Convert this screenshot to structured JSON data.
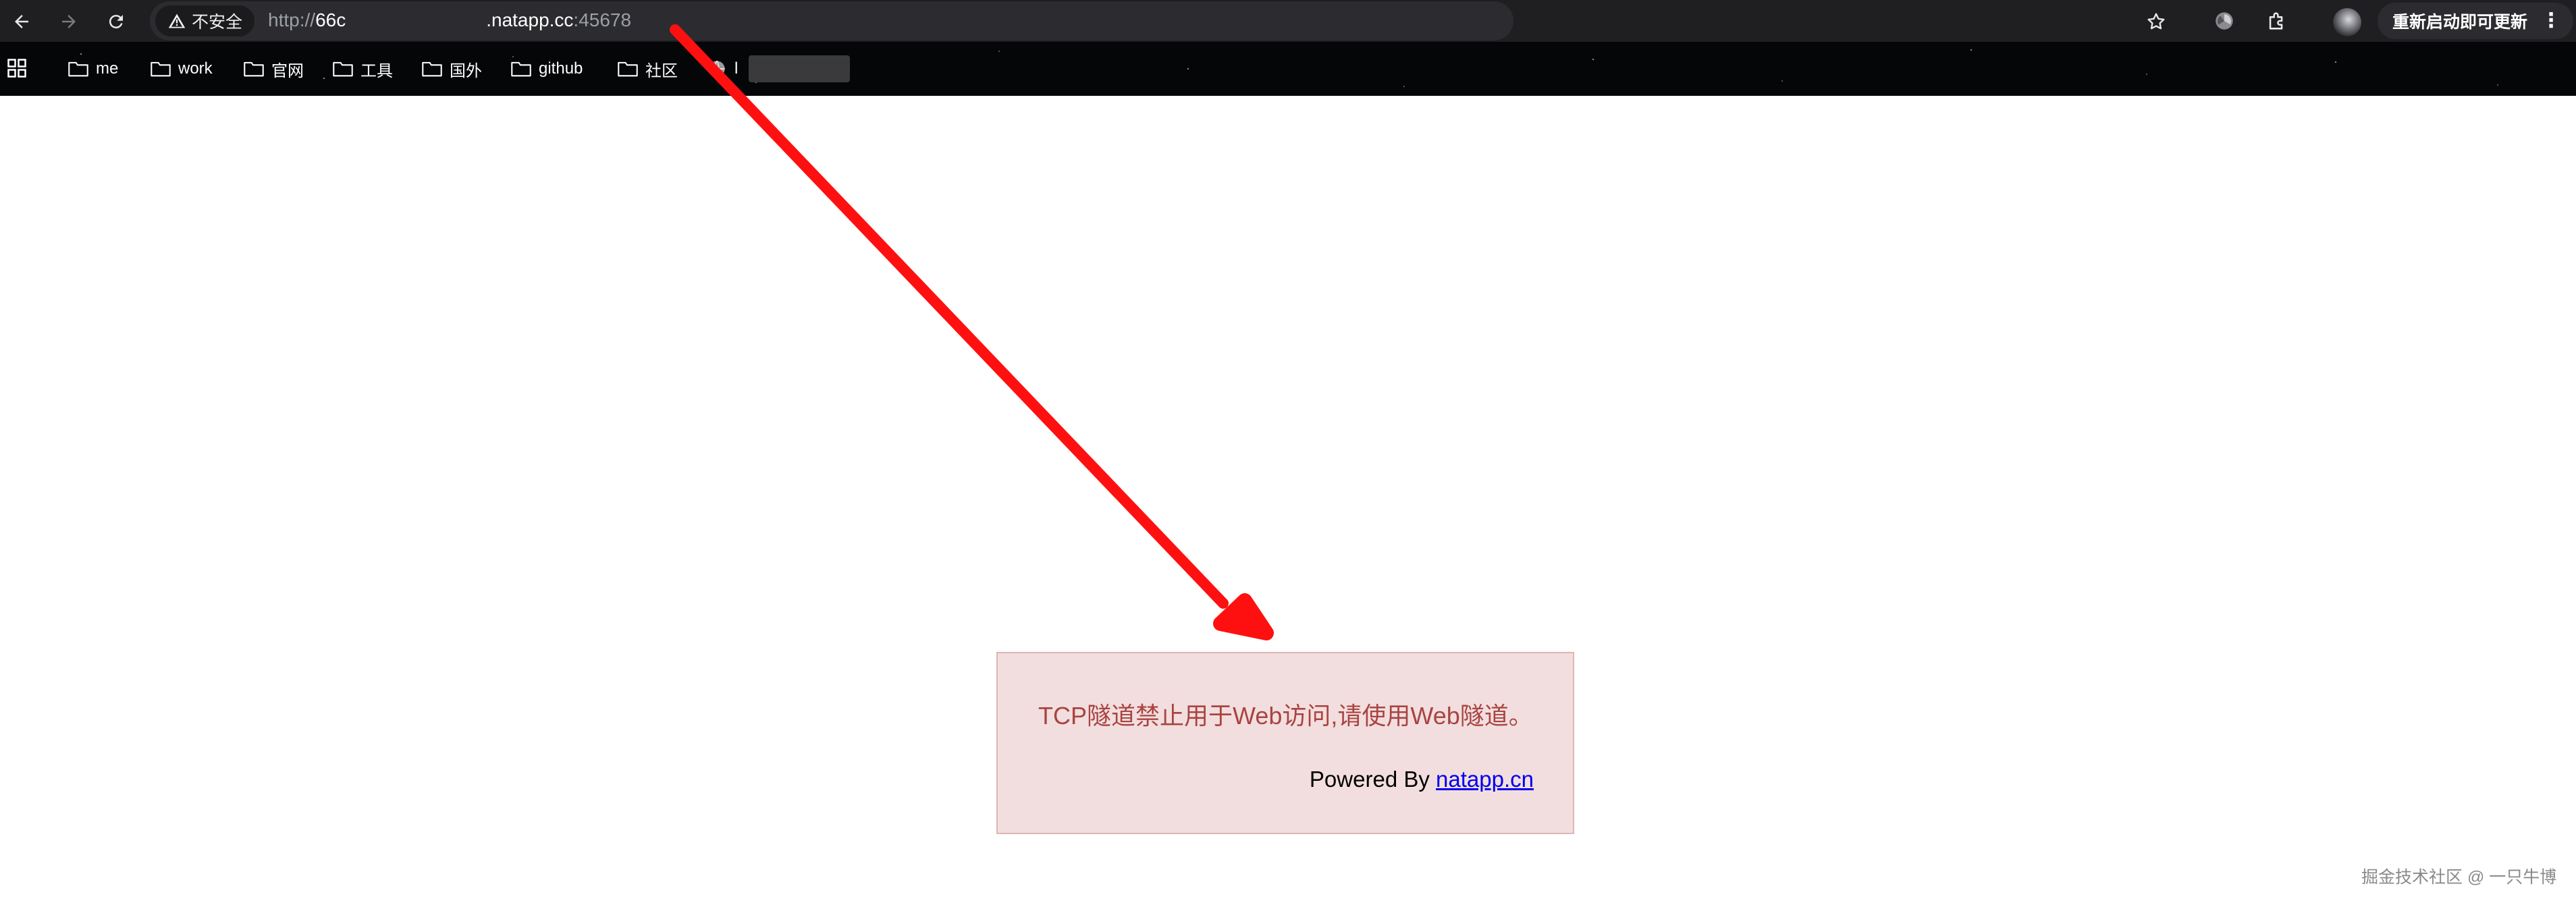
{
  "browser": {
    "security_label": "不安全",
    "url": {
      "scheme": "http://",
      "host_prefix": "66c",
      "host_suffix": ".natapp.cc",
      "port": ":45678"
    },
    "update_button_label": "重新启动即可更新",
    "menu_glyph": "⋮"
  },
  "bookmarks": {
    "items": [
      {
        "label": "me",
        "icon": "folder-icon"
      },
      {
        "label": "work",
        "icon": "folder-icon"
      },
      {
        "label": "官网",
        "icon": "folder-icon"
      },
      {
        "label": "工具",
        "icon": "folder-icon"
      },
      {
        "label": "国外",
        "icon": "folder-icon"
      },
      {
        "label": "github",
        "icon": "folder-icon"
      },
      {
        "label": "社区",
        "icon": "folder-icon"
      },
      {
        "label": "l",
        "icon": "globe-icon"
      }
    ]
  },
  "page": {
    "message": "TCP隧道禁止用于Web访问,请使用Web隧道。",
    "powered_by_label": "Powered By",
    "powered_by_link": "natapp.cn"
  },
  "colors": {
    "notice_background": "#f2dede",
    "notice_border": "#e0b5b6",
    "notice_text": "#a94442",
    "link": "#0000ee",
    "annotation_arrow": "#ff0000"
  },
  "watermark": "掘金技术社区 @ 一只牛博"
}
